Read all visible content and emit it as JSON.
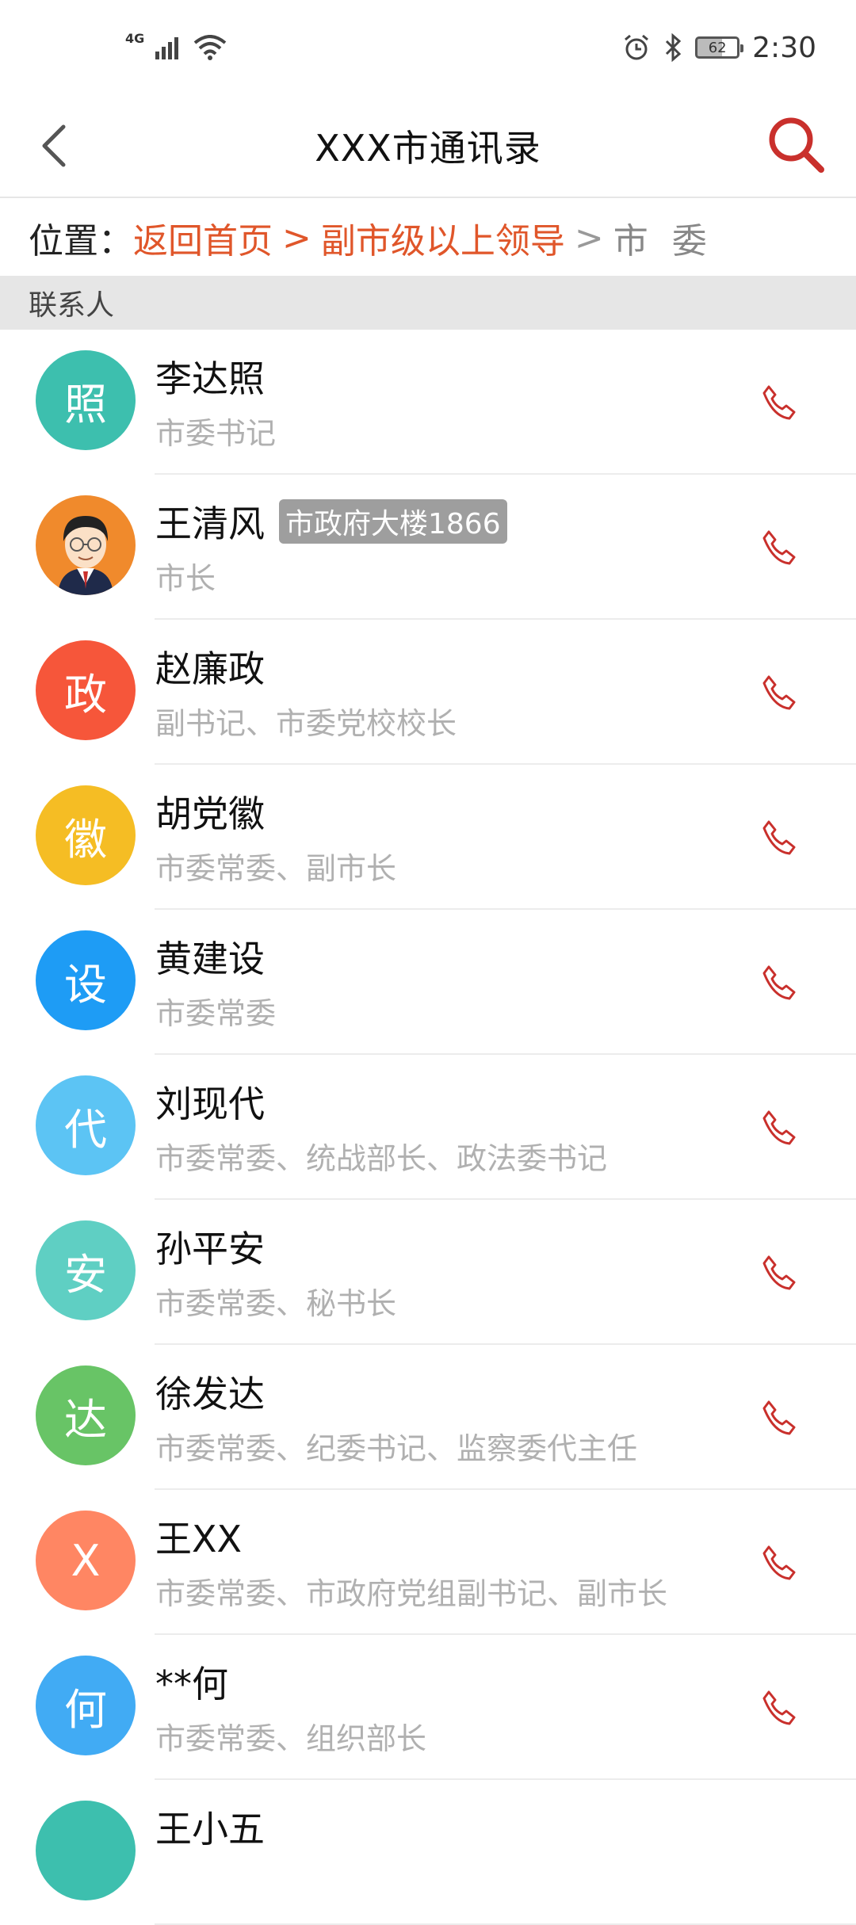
{
  "status_bar": {
    "network_label": "4G",
    "time": "2:30",
    "battery": "62",
    "icons": [
      "signal-icon",
      "wifi-icon",
      "alarm-icon",
      "bluetooth-icon",
      "battery-icon"
    ]
  },
  "nav": {
    "title": "XXX市通讯录",
    "back_icon": "back-chevron-icon",
    "search_icon": "search-icon",
    "accent_color": "#c9302c"
  },
  "location": {
    "label": "位置：",
    "links": [
      "返回首页",
      "副市级以上领导"
    ],
    "separator": ">",
    "current": "市 委"
  },
  "section": {
    "header": "联系人"
  },
  "contacts": [
    {
      "avatar_text": "照",
      "color": "#3dbfae",
      "name": "李达照",
      "title": "市委书记"
    },
    {
      "avatar_text": "",
      "photo": true,
      "color": "#f08a2c",
      "name": "王清风",
      "tag": "市政府大楼1866",
      "title": "市长"
    },
    {
      "avatar_text": "政",
      "color": "#f6563a",
      "name": "赵廉政",
      "title": "副书记、市委党校校长"
    },
    {
      "avatar_text": "徽",
      "color": "#f5bd24",
      "name": "胡党徽",
      "title": "市委常委、副市长"
    },
    {
      "avatar_text": "设",
      "color": "#1e9cf5",
      "name": "黄建设",
      "title": "市委常委"
    },
    {
      "avatar_text": "代",
      "color": "#5cc4f4",
      "name": "刘现代",
      "title": "市委常委、统战部长、政法委书记"
    },
    {
      "avatar_text": "安",
      "color": "#5fcfc3",
      "name": "孙平安",
      "title": "市委常委、秘书长"
    },
    {
      "avatar_text": "达",
      "color": "#68c466",
      "name": "徐发达",
      "title": "市委常委、纪委书记、监察委代主任"
    },
    {
      "avatar_text": "X",
      "color": "#ff8663",
      "name": "王XX",
      "title": "市委常委、市政府党组副书记、副市长"
    },
    {
      "avatar_text": "何",
      "color": "#41abf4",
      "name": "**何",
      "title": "市委常委、组织部长"
    },
    {
      "avatar_text": "",
      "color": "#3dbfae",
      "name": "王小五",
      "title": ""
    }
  ],
  "phone_icon_color": "#c9302c"
}
